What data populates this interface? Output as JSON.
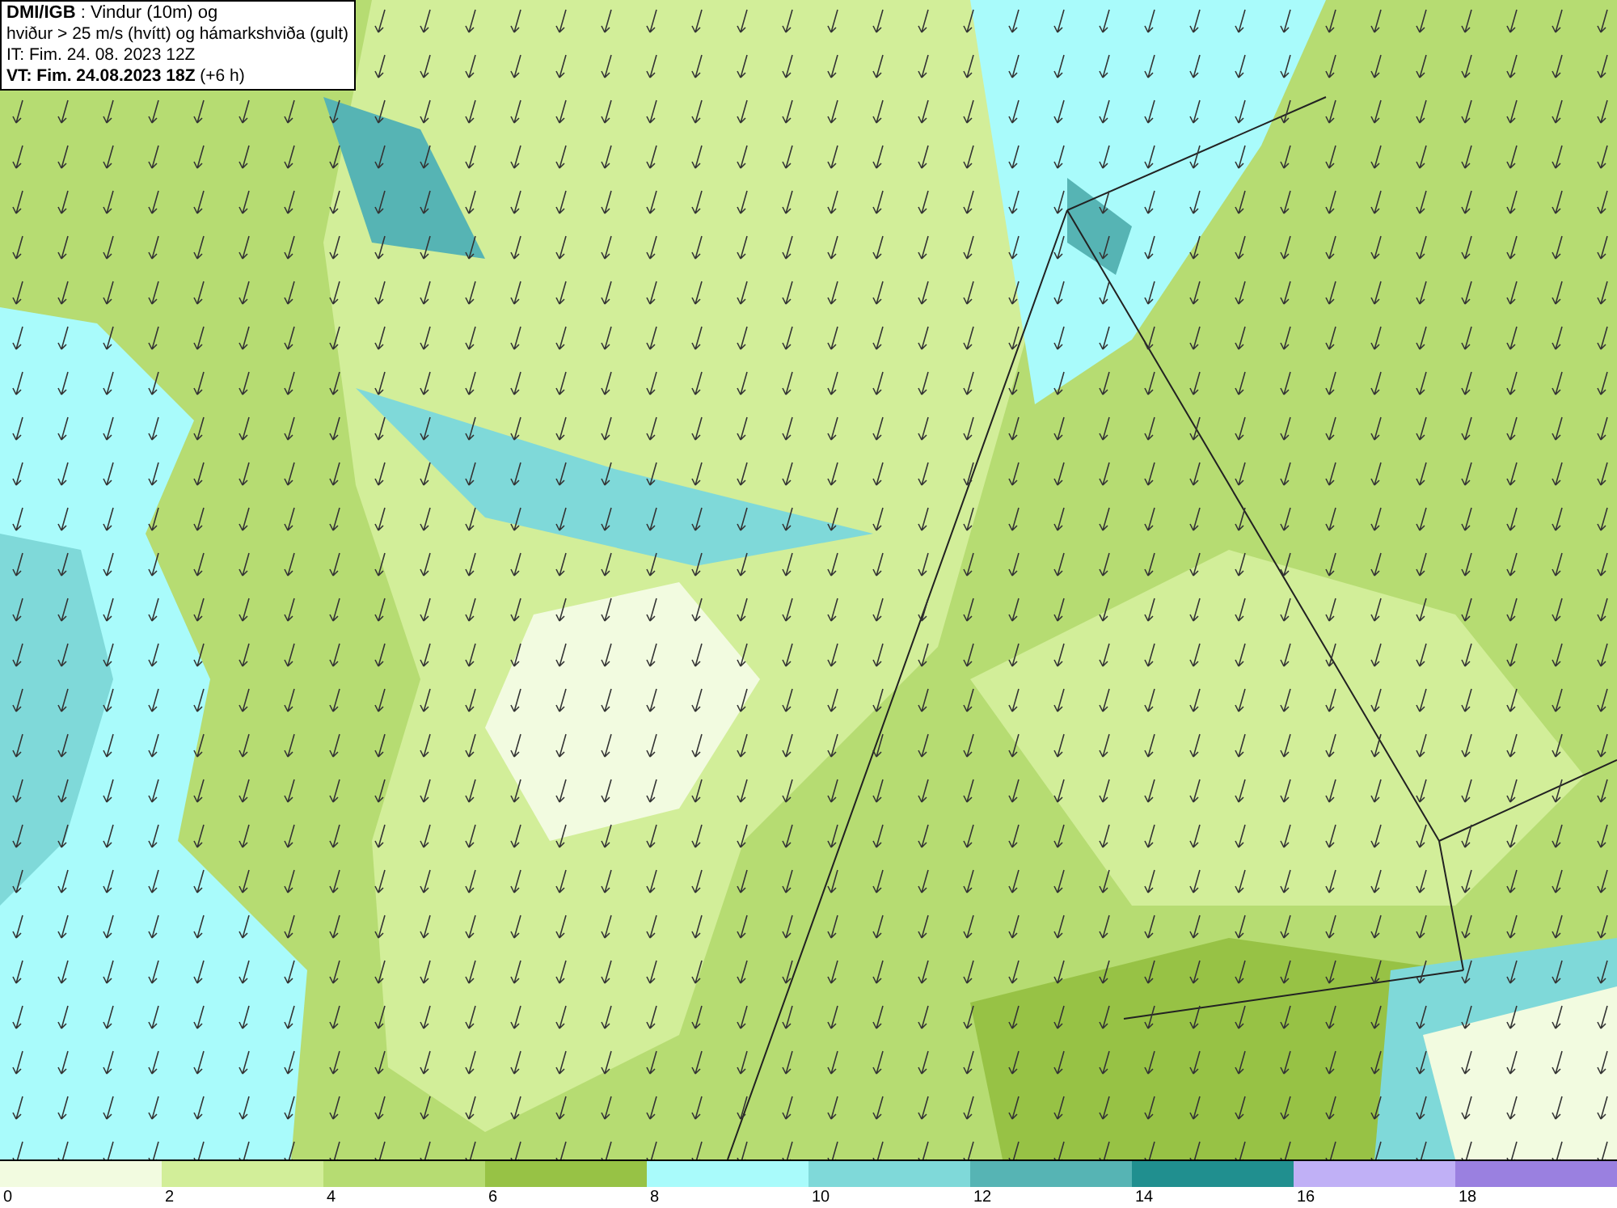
{
  "info_box": {
    "lines": [
      "**DMI/IGB** : Vindur (10m) og",
      "hviður > 25 m/s (hvítt) og hámarkshviða (gult)",
      "IT: Fim. 24. 08. 2023 12Z",
      "**VT: Fim. 24.08.2023 18Z** (+6 h)"
    ]
  },
  "legend": [
    {
      "label": "0",
      "color": "#f2fbe0"
    },
    {
      "label": "2",
      "color": "#d2ee99"
    },
    {
      "label": "4",
      "color": "#b6dc72"
    },
    {
      "label": "6",
      "color": "#97c245"
    },
    {
      "label": "8",
      "color": "#a9fbfb"
    },
    {
      "label": "10",
      "color": "#7fd9d9"
    },
    {
      "label": "12",
      "color": "#56b4b4"
    },
    {
      "label": "14",
      "color": "#208f8f"
    },
    {
      "label": "16",
      "color": "#c0b0f6"
    },
    {
      "label": "18",
      "color": "#9a80e0"
    }
  ]
}
